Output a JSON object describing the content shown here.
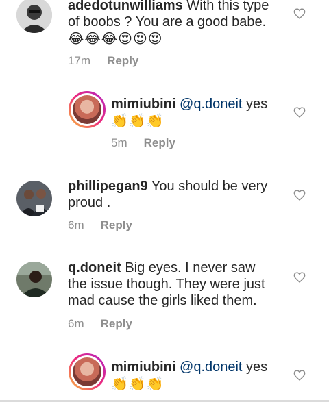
{
  "comments": [
    {
      "username": "adedotunwilliams",
      "text_line1": " With this type",
      "text_line2": "of boobs ? You are a good babe.",
      "emoji": "😂😂😂😍😍😍",
      "time": "17m",
      "reply_label": "Reply"
    },
    {
      "username": "mimiubini",
      "mention": "@q.doneit",
      "text": " yes",
      "emoji": "👏👏👏",
      "time": "5m",
      "reply_label": "Reply"
    },
    {
      "username": "phillipegan9",
      "text_line1": " You should be very",
      "text_line2": "proud .",
      "time": "6m",
      "reply_label": "Reply"
    },
    {
      "username": "q.doneit",
      "text_line1": " Big eyes. I never saw",
      "text_line2": "the issue though. They were just",
      "text_line3": "mad cause the girls liked them.",
      "time": "6m",
      "reply_label": "Reply"
    },
    {
      "username": "mimiubini",
      "mention": "@q.doneit",
      "text": " yes",
      "emoji": "👏👏👏"
    }
  ],
  "colors": {
    "mention": "#003569",
    "meta": "#8e8e8e",
    "text": "#262626"
  },
  "icons": {
    "like": "heart-outline-icon"
  }
}
